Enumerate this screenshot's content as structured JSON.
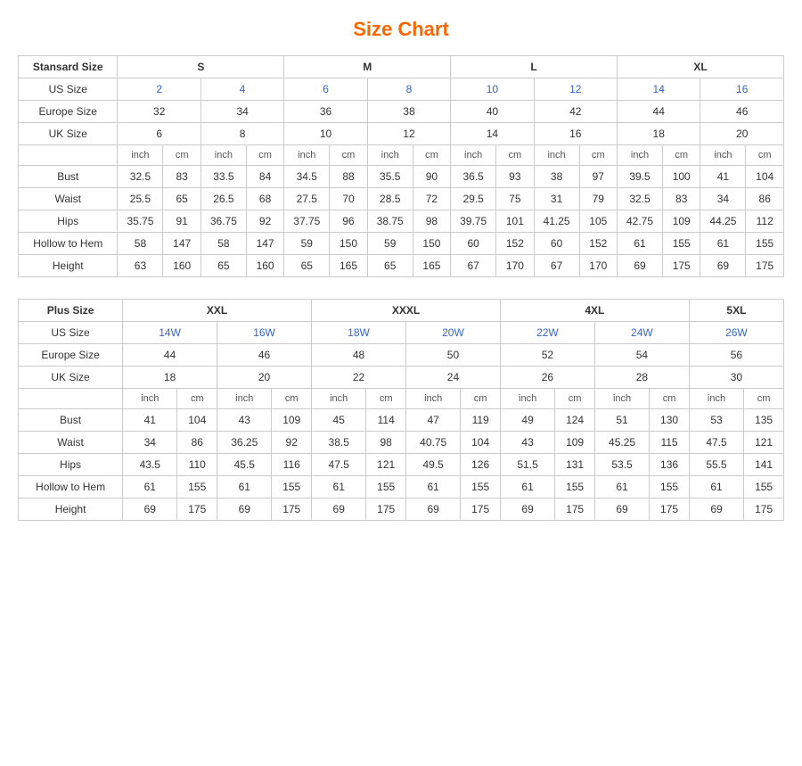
{
  "title": "Size Chart",
  "standard": {
    "title": "Stansard Size",
    "size_groups": [
      "S",
      "M",
      "L",
      "XL"
    ],
    "us_sizes": [
      "2",
      "4",
      "6",
      "8",
      "10",
      "12",
      "14",
      "16"
    ],
    "europe_sizes": [
      "32",
      "34",
      "36",
      "38",
      "40",
      "42",
      "44",
      "46"
    ],
    "uk_sizes": [
      "6",
      "8",
      "10",
      "12",
      "14",
      "16",
      "18",
      "20"
    ],
    "inch_label": "inch",
    "cm_label": "cm",
    "measurements": {
      "Bust": [
        "32.5",
        "83",
        "33.5",
        "84",
        "34.5",
        "88",
        "35.5",
        "90",
        "36.5",
        "93",
        "38",
        "97",
        "39.5",
        "100",
        "41",
        "104"
      ],
      "Waist": [
        "25.5",
        "65",
        "26.5",
        "68",
        "27.5",
        "70",
        "28.5",
        "72",
        "29.5",
        "75",
        "31",
        "79",
        "32.5",
        "83",
        "34",
        "86"
      ],
      "Hips": [
        "35.75",
        "91",
        "36.75",
        "92",
        "37.75",
        "96",
        "38.75",
        "98",
        "39.75",
        "101",
        "41.25",
        "105",
        "42.75",
        "109",
        "44.25",
        "112"
      ],
      "Hollow to Hem": [
        "58",
        "147",
        "58",
        "147",
        "59",
        "150",
        "59",
        "150",
        "60",
        "152",
        "60",
        "152",
        "61",
        "155",
        "61",
        "155"
      ],
      "Height": [
        "63",
        "160",
        "65",
        "160",
        "65",
        "165",
        "65",
        "165",
        "67",
        "170",
        "67",
        "170",
        "69",
        "175",
        "69",
        "175"
      ]
    }
  },
  "plus": {
    "title": "Plus Size",
    "size_groups": [
      "XXL",
      "XXXL",
      "4XL",
      "5XL"
    ],
    "us_sizes": [
      "14W",
      "16W",
      "18W",
      "20W",
      "22W",
      "24W",
      "26W"
    ],
    "europe_sizes": [
      "44",
      "46",
      "48",
      "50",
      "52",
      "54",
      "56"
    ],
    "uk_sizes": [
      "18",
      "20",
      "22",
      "24",
      "26",
      "28",
      "30"
    ],
    "inch_label": "inch",
    "cm_label": "cm",
    "measurements": {
      "Bust": [
        "41",
        "104",
        "43",
        "109",
        "45",
        "114",
        "47",
        "119",
        "49",
        "124",
        "51",
        "130",
        "53",
        "135"
      ],
      "Waist": [
        "34",
        "86",
        "36.25",
        "92",
        "38.5",
        "98",
        "40.75",
        "104",
        "43",
        "109",
        "45.25",
        "115",
        "47.5",
        "121"
      ],
      "Hips": [
        "43.5",
        "110",
        "45.5",
        "116",
        "47.5",
        "121",
        "49.5",
        "126",
        "51.5",
        "131",
        "53.5",
        "136",
        "55.5",
        "141"
      ],
      "Hollow to Hem": [
        "61",
        "155",
        "61",
        "155",
        "61",
        "155",
        "61",
        "155",
        "61",
        "155",
        "61",
        "155",
        "61",
        "155"
      ],
      "Height": [
        "69",
        "175",
        "69",
        "175",
        "69",
        "175",
        "69",
        "175",
        "69",
        "175",
        "69",
        "175",
        "69",
        "175"
      ]
    }
  }
}
